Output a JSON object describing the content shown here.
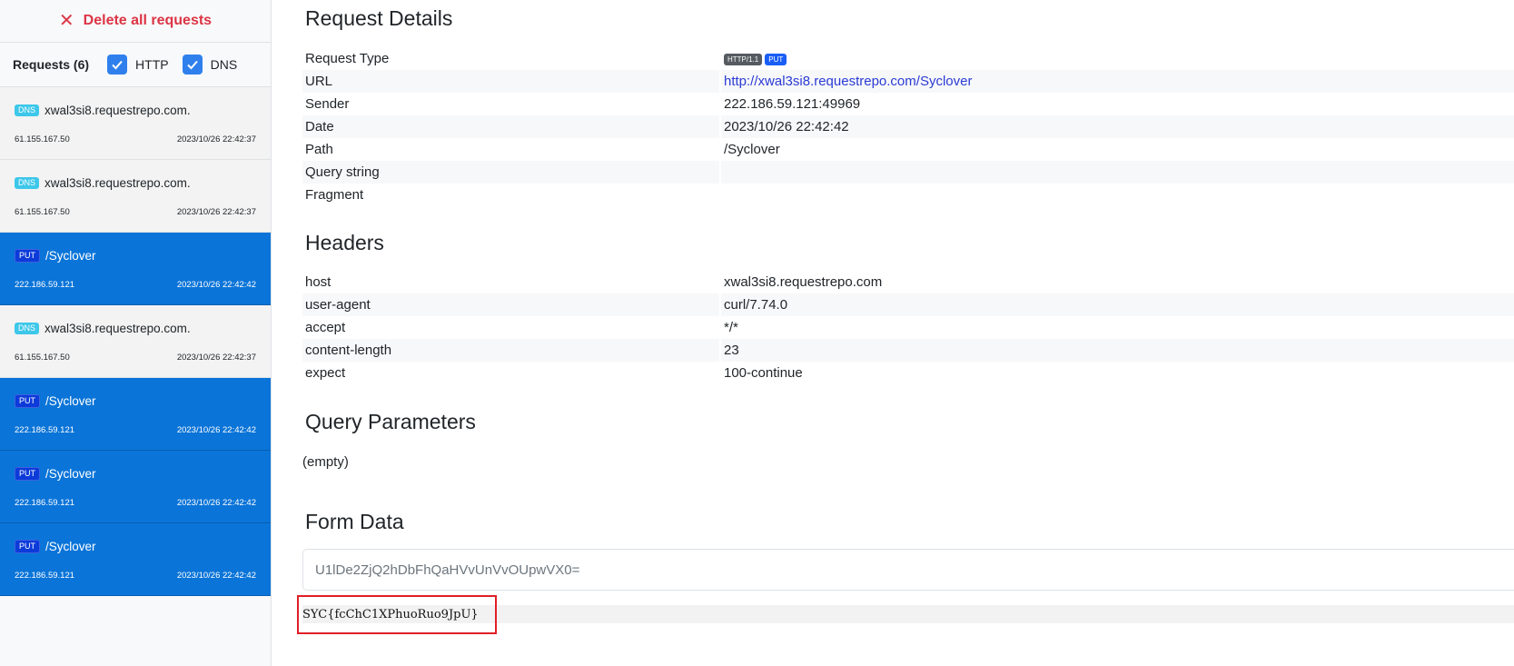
{
  "sidebar": {
    "delete_label": "Delete all requests",
    "requests_count_label": "Requests (6)",
    "filter_http_label": "HTTP",
    "filter_dns_label": "DNS",
    "requests": [
      {
        "type": "DNS",
        "title": "xwal3si8.requestrepo.com.",
        "ip": "61.155.167.50",
        "time": "2023/10/26 22:42:37"
      },
      {
        "type": "DNS",
        "title": "xwal3si8.requestrepo.com.",
        "ip": "61.155.167.50",
        "time": "2023/10/26 22:42:37"
      },
      {
        "type": "PUT",
        "title": "/Syclover",
        "ip": "222.186.59.121",
        "time": "2023/10/26 22:42:42"
      },
      {
        "type": "DNS",
        "title": "xwal3si8.requestrepo.com.",
        "ip": "61.155.167.50",
        "time": "2023/10/26 22:42:37"
      },
      {
        "type": "PUT",
        "title": "/Syclover",
        "ip": "222.186.59.121",
        "time": "2023/10/26 22:42:42"
      },
      {
        "type": "PUT",
        "title": "/Syclover",
        "ip": "222.186.59.121",
        "time": "2023/10/26 22:42:42"
      },
      {
        "type": "PUT",
        "title": "/Syclover",
        "ip": "222.186.59.121",
        "time": "2023/10/26 22:42:42"
      }
    ]
  },
  "details": {
    "title": "Request Details",
    "request_type_label": "Request Type",
    "http_version_badge": "HTTP/1.1",
    "method_badge": "PUT",
    "url_label": "URL",
    "url_value": "http://xwal3si8.requestrepo.com/Syclover",
    "sender_label": "Sender",
    "sender_value": "222.186.59.121:49969",
    "date_label": "Date",
    "date_value": "2023/10/26 22:42:42",
    "path_label": "Path",
    "path_value": "/Syclover",
    "query_label": "Query string",
    "query_value": "",
    "fragment_label": "Fragment",
    "fragment_value": ""
  },
  "headers": {
    "title": "Headers",
    "rows": [
      {
        "key": "host",
        "value": "xwal3si8.requestrepo.com"
      },
      {
        "key": "user-agent",
        "value": "curl/7.74.0"
      },
      {
        "key": "accept",
        "value": "*/*"
      },
      {
        "key": "content-length",
        "value": "23"
      },
      {
        "key": "expect",
        "value": "100-continue"
      }
    ]
  },
  "query_params": {
    "title": "Query Parameters",
    "empty_text": "(empty)"
  },
  "form_data": {
    "title": "Form Data",
    "raw_value": "U1lDe2ZjQ2hDbFhQaHVvUnVvOUpwVX0=",
    "decoded_value": "SYC{fcChC1XPhuoRuo9JpU}"
  },
  "colors": {
    "accent_blue": "#0a74d8",
    "delete_red": "#dc3545",
    "highlight_red": "#e01f26"
  }
}
